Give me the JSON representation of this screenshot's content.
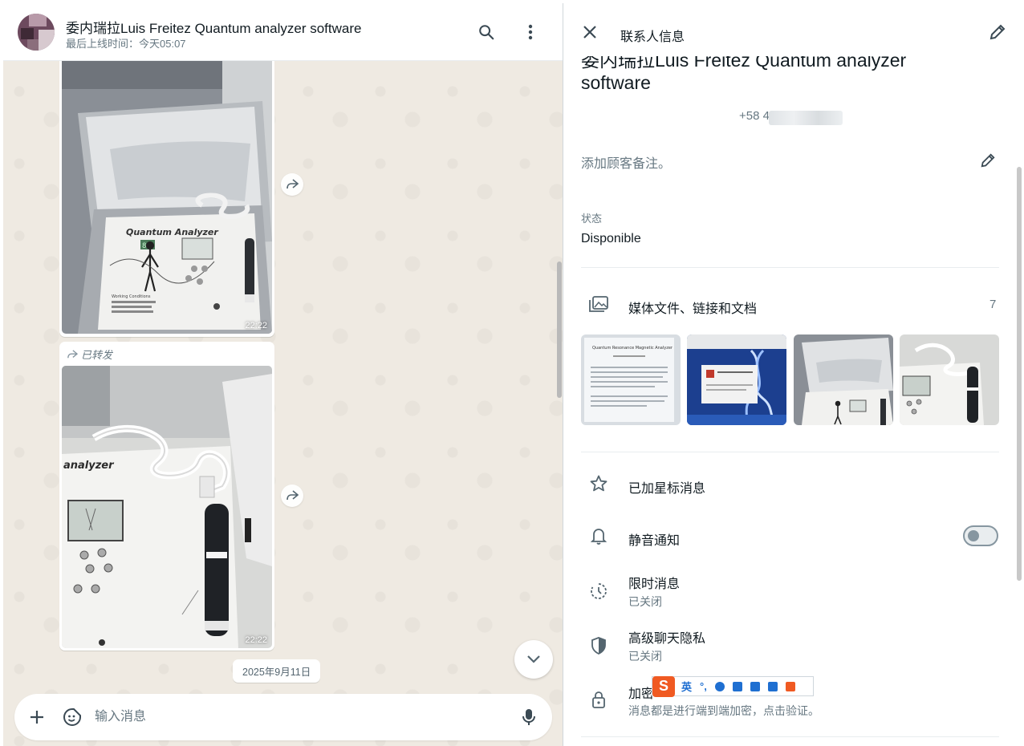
{
  "chat": {
    "title": "委内瑞拉Luis Freitez Quantum analyzer software",
    "last_seen": "最后上线时间：今天05:07",
    "messages": [
      {
        "time": "22:22"
      },
      {
        "forwarded_label": "已转发",
        "time": "22:22"
      }
    ],
    "date_chip": "2025年9月11日",
    "composer": {
      "placeholder": "输入消息"
    }
  },
  "device": {
    "brand_text": "Quantum Analyzer",
    "display_digits": "88",
    "panel_label": "Working Conditions",
    "model_text": "analyzer"
  },
  "contact_info": {
    "header_title": "联系人信息",
    "name_line1": "委内瑞拉Luis Freitez Quantum analyzer",
    "name_line2": "software",
    "phone_prefix": "+58 4",
    "note_placeholder": "添加顾客备注。",
    "about_label": "状态",
    "about_value": "Disponible",
    "media": {
      "label": "媒体文件、链接和文档",
      "count": "7",
      "thumb_doc_title": "Quantum Resonance Magnetic Analyzer"
    },
    "options": [
      {
        "title": "已加星标消息",
        "icon": "star-icon"
      },
      {
        "title": "静音通知",
        "icon": "bell-icon",
        "toggle_on": false
      },
      {
        "title": "限时消息",
        "subtitle": "已关闭",
        "icon": "timer-icon"
      },
      {
        "title": "高级聊天隐私",
        "subtitle": "已关闭",
        "icon": "shield-icon"
      },
      {
        "title": "加密",
        "subtitle": "消息都是进行端到端加密，点击验证。",
        "icon": "lock-icon"
      }
    ]
  },
  "ime_toolbar": {
    "logo": "S",
    "mode": "英",
    "punct": "°,"
  },
  "colors": {
    "chat_bg": "#efeae2",
    "accent_text": "#111b21",
    "muted_text": "#667781",
    "ime_orange": "#f05a22"
  }
}
